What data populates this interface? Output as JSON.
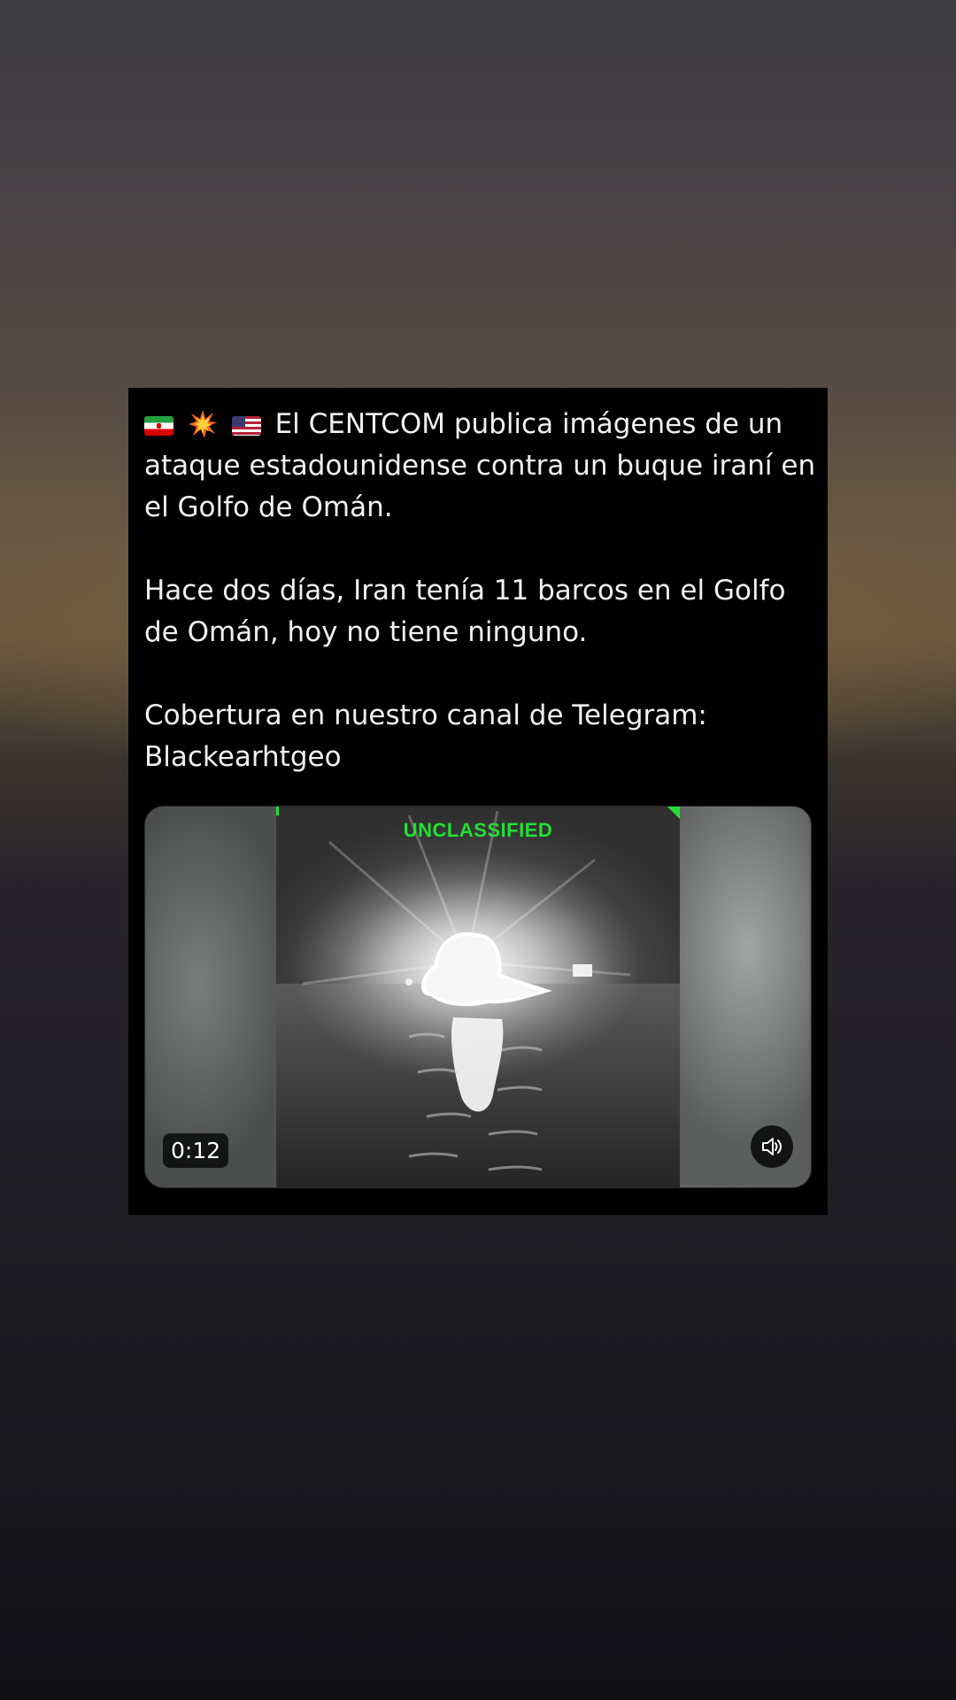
{
  "post": {
    "paragraph_1": "El CENTCOM publica imágenes de un ataque estadounidense contra un buque iraní en el Golfo de Omán.",
    "paragraph_2": "Hace dos días, Iran tenía 11 barcos en el Golfo de Omán, hoy no tiene ninguno.",
    "paragraph_3": "Cobertura en nuestro canal de Telegram: Blackearhtgeo",
    "emojis": [
      "iran-flag",
      "explosion",
      "us-flag"
    ]
  },
  "video": {
    "overlay_label": "UNCLASSIFIED",
    "duration": "0:12",
    "sound_icon": "speaker-icon"
  },
  "colors": {
    "card_background": "#000000",
    "text": "#f1f1f1",
    "overlay_label": "#22e032"
  }
}
